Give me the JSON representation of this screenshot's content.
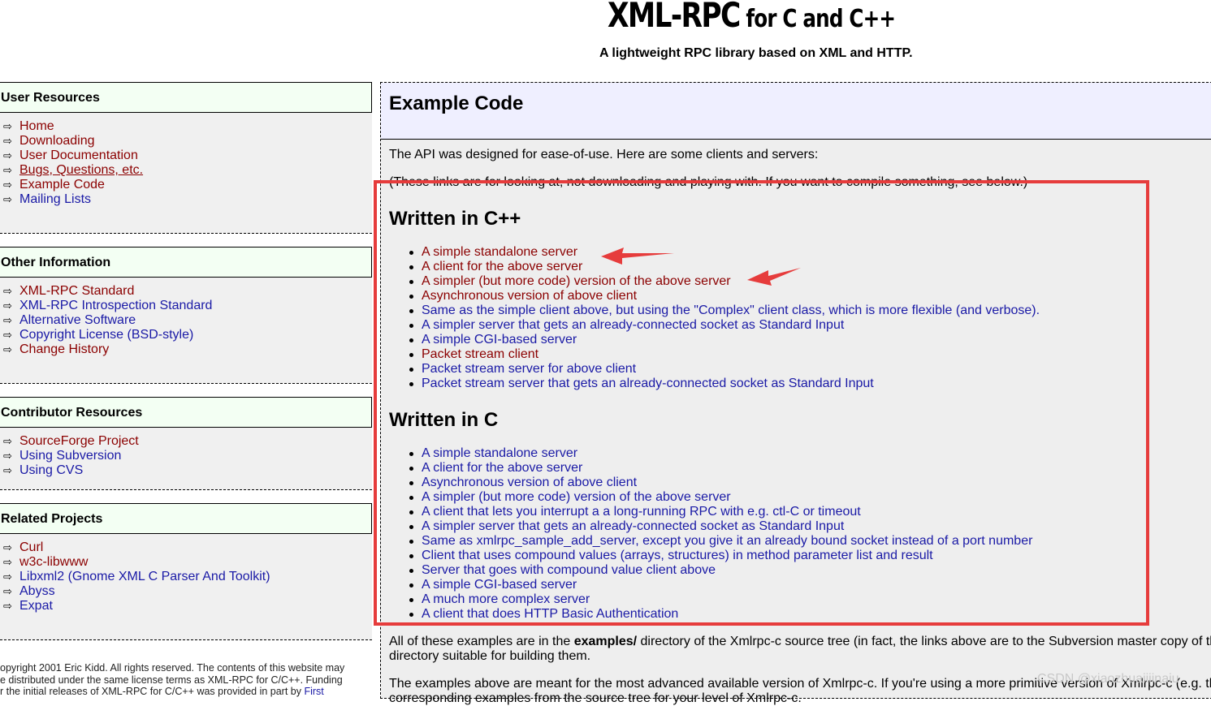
{
  "header": {
    "logo_main": "XML-RPC",
    "logo_small": " for C and C++",
    "tagline": "A lightweight RPC library based on XML and HTTP."
  },
  "sidebar": {
    "sections": [
      {
        "title": "User Resources",
        "items": [
          {
            "label": "Home",
            "color": "#8b0000"
          },
          {
            "label": "Downloading",
            "color": "#8b0000"
          },
          {
            "label": "User Documentation",
            "color": "#8b0000"
          },
          {
            "label": "Bugs, Questions, etc.",
            "color": "#8b0000",
            "underline": true
          },
          {
            "label": "Example Code",
            "color": "#8b0000"
          },
          {
            "label": "Mailing Lists",
            "color": "#1a1aa6"
          }
        ]
      },
      {
        "title": "Other Information",
        "items": [
          {
            "label": "XML-RPC Standard",
            "color": "#8b0000"
          },
          {
            "label": "XML-RPC Introspection Standard",
            "color": "#1a1aa6"
          },
          {
            "label": "Alternative Software",
            "color": "#1a1aa6"
          },
          {
            "label": "Copyright License (BSD-style)",
            "color": "#1a1aa6"
          },
          {
            "label": "Change History",
            "color": "#8b0000"
          }
        ]
      },
      {
        "title": "Contributor Resources",
        "items": [
          {
            "label": "SourceForge Project",
            "color": "#8b0000"
          },
          {
            "label": "Using Subversion",
            "color": "#1a1aa6"
          },
          {
            "label": "Using CVS",
            "color": "#1a1aa6"
          }
        ]
      },
      {
        "title": "Related Projects",
        "items": [
          {
            "label": "Curl",
            "color": "#8b0000"
          },
          {
            "label": "w3c-libwww",
            "color": "#8b0000"
          },
          {
            "label": "Libxml2 (Gnome XML C Parser And Toolkit)",
            "color": "#1a1aa6"
          },
          {
            "label": "Abyss",
            "color": "#1a1aa6"
          },
          {
            "label": "Expat",
            "color": "#1a1aa6"
          }
        ]
      }
    ],
    "copyright": [
      "opyright 2001 Eric Kidd. All rights reserved. The contents of this website may",
      "e distributed under the same license terms as XML-RPC for C/C++. Funding",
      "r the initial releases of XML-RPC for C/C++ was provided in part by "
    ],
    "copyright_link": "First"
  },
  "main": {
    "title": "Example Code",
    "intro": "The API was designed for ease-of-use. Here are some clients and servers:",
    "note": "(These links are for looking at, not downloading and playing with. If you want to compile something, see below.)",
    "cpp_heading": "Written in C++",
    "cpp_items": [
      {
        "label": "A simple standalone server",
        "color": "#8b0000"
      },
      {
        "label": "A client for the above server",
        "color": "#8b0000"
      },
      {
        "label": "A simpler (but more code) version of the above server",
        "color": "#8b0000"
      },
      {
        "label": "Asynchronous version of above client",
        "color": "#8b0000"
      },
      {
        "label": "Same as the simple client above, but using the \"Complex\" client class, which is more flexible (and verbose).",
        "color": "#1a1aa6"
      },
      {
        "label": "A simpler server that gets an already-connected socket as Standard Input",
        "color": "#1a1aa6"
      },
      {
        "label": "A simple CGI-based server",
        "color": "#1a1aa6"
      },
      {
        "label": "Packet stream client",
        "color": "#8b0000"
      },
      {
        "label": "Packet stream server for above client",
        "color": "#1a1aa6"
      },
      {
        "label": "Packet stream server that gets an already-connected socket as Standard Input",
        "color": "#1a1aa6"
      }
    ],
    "c_heading": "Written in C",
    "c_items": [
      {
        "label": "A simple standalone server",
        "color": "#1a1aa6"
      },
      {
        "label": "A client for the above server",
        "color": "#1a1aa6"
      },
      {
        "label": "Asynchronous version of above client",
        "color": "#1a1aa6"
      },
      {
        "label": "A simpler (but more code) version of the above server",
        "color": "#1a1aa6"
      },
      {
        "label": "A client that lets you interrupt a a long-running RPC with e.g. ctl-C or timeout",
        "color": "#1a1aa6"
      },
      {
        "label": "A simpler server that gets an already-connected socket as Standard Input",
        "color": "#1a1aa6"
      },
      {
        "label": "Same as xmlrpc_sample_add_server, except you give it an already bound socket instead of a port number",
        "color": "#1a1aa6"
      },
      {
        "label": "Client that uses compound values (arrays, structures) in method parameter list and result",
        "color": "#1a1aa6"
      },
      {
        "label": "Server that goes with compound value client above",
        "color": "#1a1aa6"
      },
      {
        "label": "A simple CGI-based server",
        "color": "#1a1aa6"
      },
      {
        "label": "A much more complex server",
        "color": "#1a1aa6"
      },
      {
        "label": "A client that does HTTP Basic Authentication",
        "color": "#1a1aa6"
      }
    ],
    "footer1_pre": "All of these examples are in the ",
    "footer1_bold": "examples/",
    "footer1_post": " directory of the Xmlrpc-c source tree (in fact, the links above are to the Subversion master copy of th",
    "footer1_line2": "directory suitable for building them.",
    "footer2": "The examples above are meant for the most advanced available version of Xmlrpc-c. If you're using a more primitive version of Xmlrpc-c (e.g. th",
    "footer2_line2": "corresponding examples from the source tree for your level of Xmlrpc-c."
  },
  "annotation": {
    "box_color": "#e63c3c"
  },
  "watermark": "CSDN @xiaozhuaiiiinaiu"
}
